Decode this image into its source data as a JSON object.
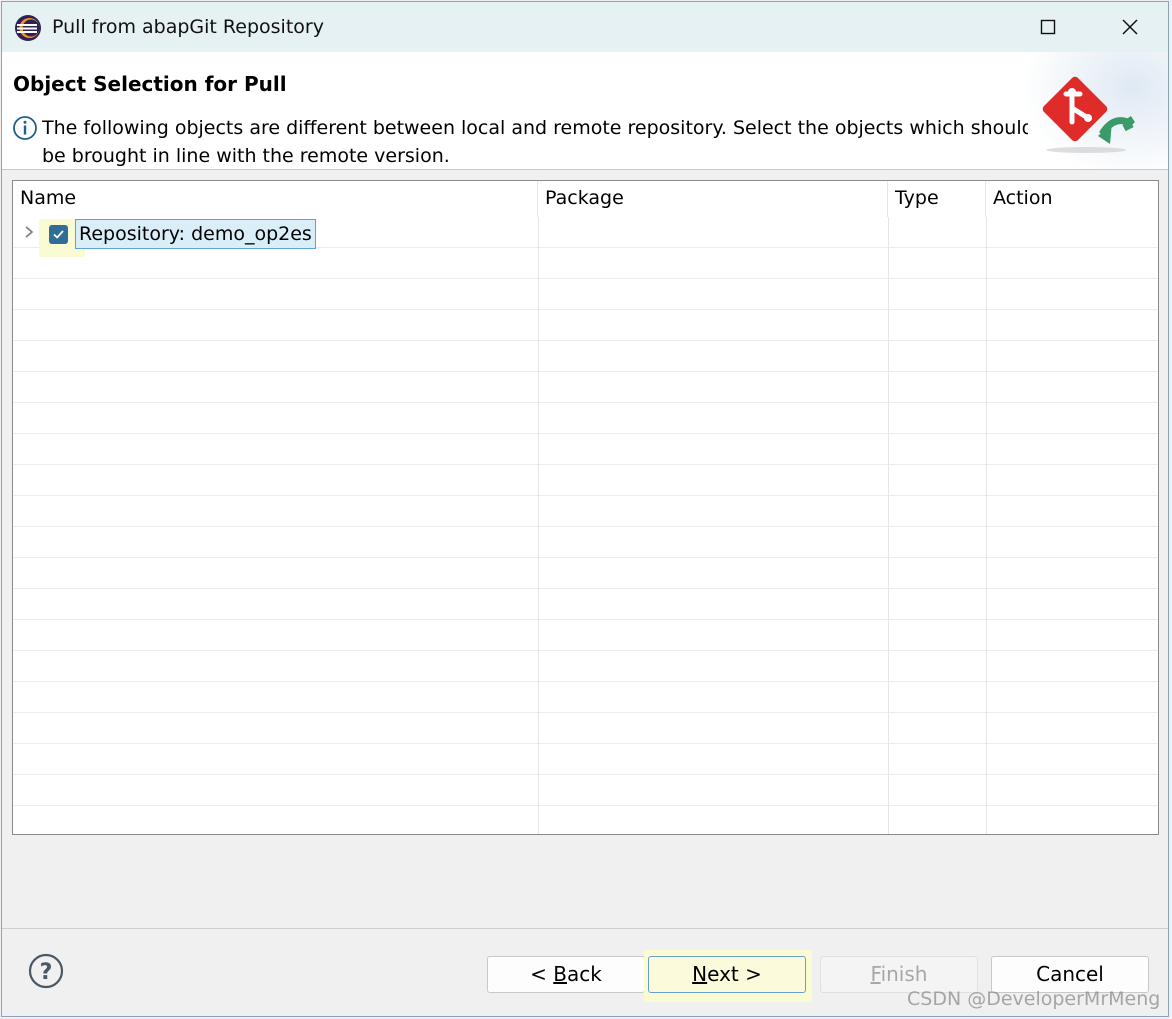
{
  "window": {
    "title": "Pull from abapGit Repository"
  },
  "header": {
    "title": "Object Selection for Pull",
    "description": "The following objects are different between local and remote repository. Select the objects which should be brought in line with the remote version."
  },
  "table": {
    "columns": [
      "Name",
      "Package",
      "Type",
      "Action"
    ],
    "rows": [
      {
        "name": "Repository: demo_op2es",
        "package": "",
        "type": "",
        "action": "",
        "checked": true,
        "expanded": false
      }
    ]
  },
  "buttons": {
    "back": {
      "mnemonic": "B",
      "rest": "ack",
      "prefix": "< "
    },
    "next": {
      "mnemonic": "N",
      "rest": "ext >"
    },
    "finish": {
      "mnemonic": "F",
      "rest": "inish"
    },
    "cancel": "Cancel"
  },
  "watermark": "CSDN @DeveloperMrMeng",
  "colors": {
    "titlebar": "#e6f1f4",
    "checkbox": "#2f6e96",
    "selection": "#d9eef8",
    "banner_red": "#e02b2b",
    "banner_green": "#3a9a6a"
  }
}
